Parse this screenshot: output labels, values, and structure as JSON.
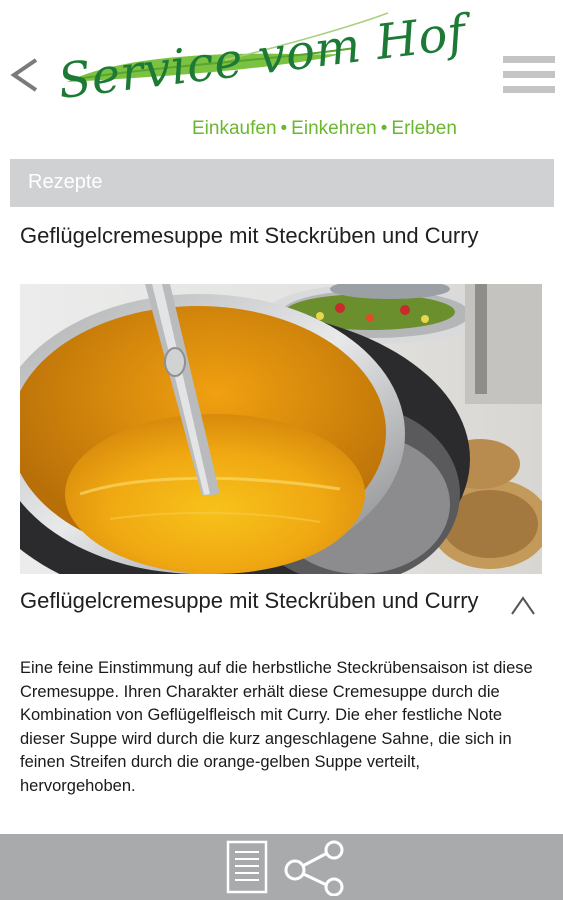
{
  "header": {
    "logo_name": "Service vom Hof",
    "tagline": [
      "Einkaufen",
      "Einkehren",
      "Erleben"
    ],
    "tagline_separator": "•",
    "back_icon": "chevron-left-icon",
    "menu_icon": "hamburger-menu-icon"
  },
  "section": {
    "label": "Rezepte"
  },
  "recipe": {
    "title": "Geflügelcremesuppe mit Steckrüben und Curry",
    "image_subject": "soup-tureen-photo",
    "detail_title": "Geflügelcremesuppe mit Steckrüben und Curry",
    "collapse_icon": "chevron-up-icon",
    "description": "Eine feine Einstimmung auf die herbstliche Steckrübensaison ist diese Cremesuppe. Ihren Charakter erhält diese Cremesuppe durch die Kombination von Geflügelfleisch mit Curry. Die eher festliche Note dieser Suppe wird durch die kurz angeschlagene Sahne, die sich in feinen Streifen durch die orange-gelben Suppe verteilt, hervorgehoben."
  },
  "bottom_bar": {
    "document_icon": "document-list-icon",
    "share_icon": "share-icon"
  },
  "colors": {
    "brand_dark_green": "#1c7a36",
    "brand_light_green": "#6bb82e",
    "section_bar": "#cfd1d3",
    "bottom_bar": "#a9aaab"
  }
}
